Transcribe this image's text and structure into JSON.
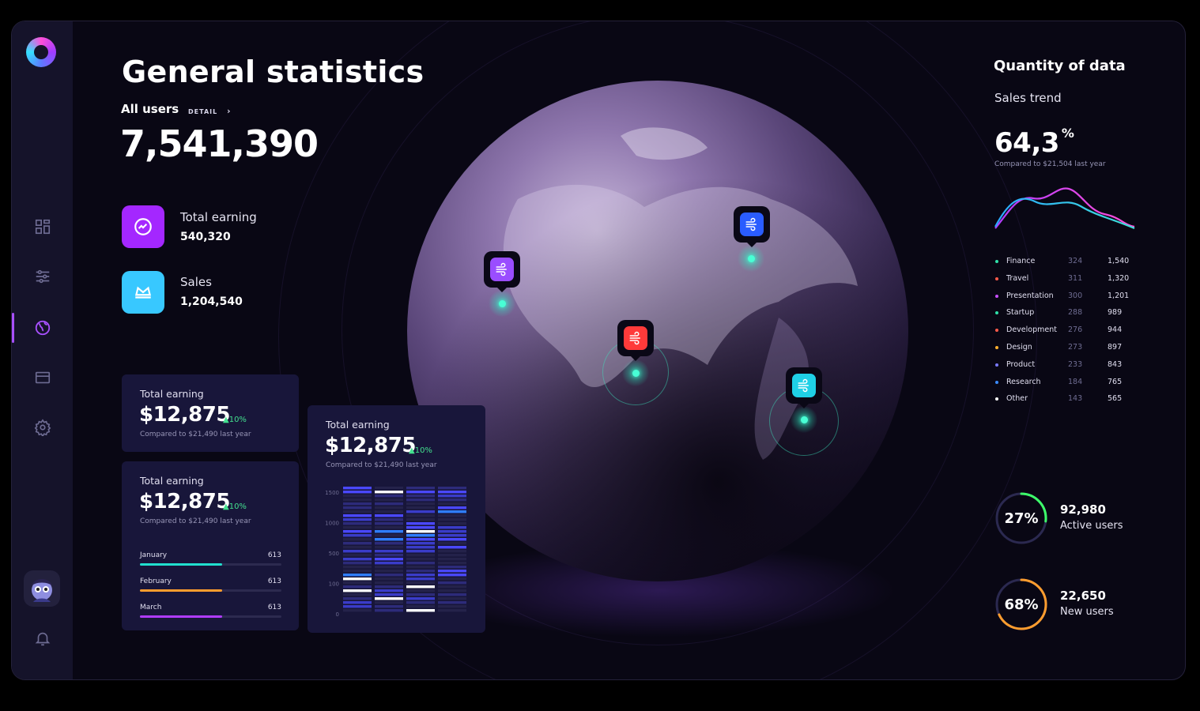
{
  "header": {
    "title": "General statistics",
    "all_users_label": "All users",
    "detail_label": "DETAIL",
    "total_users": "7,541,390"
  },
  "stats": [
    {
      "label": "Total earning",
      "value": "540,320",
      "icon": "trend-icon",
      "color": "#a427ff"
    },
    {
      "label": "Sales",
      "value": "1,204,540",
      "icon": "crown-icon",
      "color": "#38c8ff"
    }
  ],
  "cards": [
    {
      "label": "Total earning",
      "value": "$12,875",
      "change": "10%",
      "compare": "Compared to $21,490 last year"
    },
    {
      "label": "Total earning",
      "value": "$12,875",
      "change": "10%",
      "compare": "Compared to $21,490 last year"
    },
    {
      "label": "Total earning",
      "value": "$12,875",
      "change": "10%",
      "compare": "Compared to $21,490 last year"
    }
  ],
  "months": [
    {
      "name": "January",
      "value": "613",
      "color": "#21e0cf",
      "fill": 0.58
    },
    {
      "name": "February",
      "value": "613",
      "color": "#ff9d2e",
      "fill": 0.58
    },
    {
      "name": "March",
      "value": "613",
      "color": "#b03cff",
      "fill": 0.58
    }
  ],
  "heatmap": {
    "y_ticks": [
      "1500",
      "1000",
      "500",
      "100",
      "0"
    ]
  },
  "right": {
    "title": "Quantity of data",
    "subtitle": "Sales trend",
    "percent": "64,3",
    "percent_sign": "%",
    "compare": "Compared to $21,504 last year"
  },
  "legend": [
    {
      "name": "Finance",
      "v1": "324",
      "v2": "1,540",
      "color": "#2fe0a8"
    },
    {
      "name": "Travel",
      "v1": "311",
      "v2": "1,320",
      "color": "#ff5a4a"
    },
    {
      "name": "Presentation",
      "v1": "300",
      "v2": "1,201",
      "color": "#c850ff"
    },
    {
      "name": "Startup",
      "v1": "288",
      "v2": "989",
      "color": "#2fe0a8"
    },
    {
      "name": "Development",
      "v1": "276",
      "v2": "944",
      "color": "#ff5a4a"
    },
    {
      "name": "Design",
      "v1": "273",
      "v2": "897",
      "color": "#ffb02e"
    },
    {
      "name": "Product",
      "v1": "233",
      "v2": "843",
      "color": "#7a7aff"
    },
    {
      "name": "Research",
      "v1": "184",
      "v2": "765",
      "color": "#3a8bff"
    },
    {
      "name": "Other",
      "v1": "143",
      "v2": "565",
      "color": "#ffffff"
    }
  ],
  "donuts": [
    {
      "percent": "27%",
      "fraction": 0.27,
      "number": "92,980",
      "label": "Active users",
      "color": "#3dff6a"
    },
    {
      "percent": "68%",
      "fraction": 0.68,
      "number": "22,650",
      "label": "New users",
      "color": "#ff9d2e"
    }
  ],
  "pins": [
    {
      "icon": "wind-icon",
      "color": "#9a4dff"
    },
    {
      "icon": "wind-icon",
      "color": "#2a5cff"
    },
    {
      "icon": "wind-icon",
      "color": "#ff3a3a"
    },
    {
      "icon": "wind-icon",
      "color": "#1fd0e6"
    }
  ],
  "sidebar": {
    "items": [
      "dashboard-icon",
      "sliders-icon",
      "globe-icon",
      "card-icon",
      "settings-icon"
    ],
    "active": "globe-icon"
  },
  "colors": {
    "accent": "#a850ff",
    "positive": "#43e08f"
  }
}
